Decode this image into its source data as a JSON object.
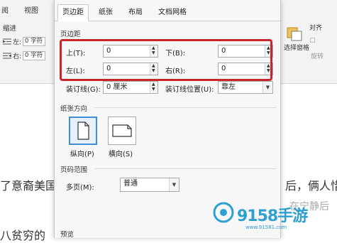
{
  "ribbon": {
    "menu_items": [
      "阅",
      "视图"
    ],
    "indent_label": "缩进",
    "left_label": "左:",
    "left_value": "0 字符",
    "right_label": "右:",
    "right_value": "0 字符",
    "right_side": {
      "align": "对齐",
      "select_pane": "选择窗格",
      "rotate": "旋转"
    }
  },
  "document": {
    "text_left": "了意裔美国",
    "text_right": "后，俩人惜",
    "text_bottom": "八贫穷的",
    "text_bottom_right": "在宁静后"
  },
  "dialog": {
    "tabs": [
      {
        "label": "页边距",
        "active": true
      },
      {
        "label": "纸张",
        "active": false
      },
      {
        "label": "布局",
        "active": false
      },
      {
        "label": "文档网格",
        "active": false
      }
    ],
    "margins": {
      "section": "页边距",
      "top_label": "上(T):",
      "top_value": "0",
      "bottom_label": "下(B):",
      "bottom_value": "0",
      "left_label": "左(L):",
      "left_value": "0",
      "right_label": "右(R):",
      "right_value": "0",
      "gutter_label": "装订线(G):",
      "gutter_value": "0 厘米",
      "gutter_pos_label": "装订线位置(U):",
      "gutter_pos_value": "靠左"
    },
    "orientation": {
      "section": "纸张方向",
      "portrait": "纵向(P)",
      "landscape": "横向(S)",
      "selected": "portrait"
    },
    "pages": {
      "section": "页码范围",
      "multiple_label": "多页(M):",
      "multiple_value": "普通"
    },
    "preview": {
      "section": "预览"
    }
  },
  "watermark": {
    "brand": "9158手游",
    "url": "www.91581.com"
  },
  "colors": {
    "highlight": "#c8252c",
    "selected_border": "#3a8fd8",
    "watermark": "#2f9fd0"
  }
}
